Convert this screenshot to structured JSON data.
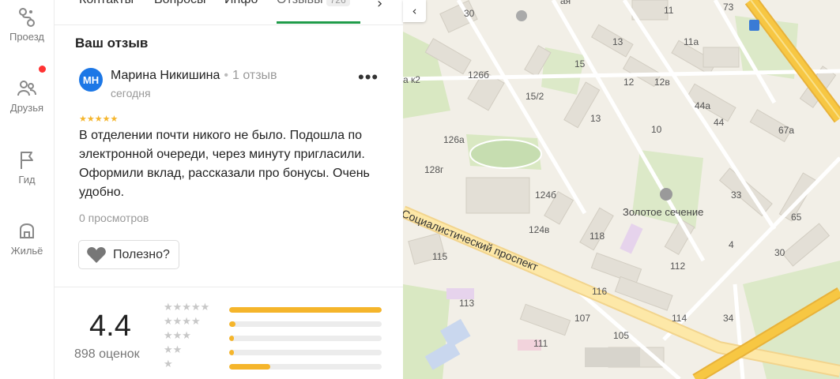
{
  "rail": {
    "items": [
      {
        "label": "Проезд",
        "icon": "route-icon"
      },
      {
        "label": "Друзья",
        "icon": "friends-icon"
      },
      {
        "label": "Гид",
        "icon": "flag-icon"
      },
      {
        "label": "Жильё",
        "icon": "house-icon"
      }
    ]
  },
  "tabs": {
    "items": [
      "Контакты",
      "Вопросы",
      "Инфо",
      "Отзывы"
    ],
    "reviews_count": "726",
    "next": "›"
  },
  "review": {
    "section_title": "Ваш отзыв",
    "avatar": "МН",
    "author": "Марина Никишина",
    "separator": "•",
    "author_reviews": "1 отзыв",
    "date": "сегодня",
    "more": "•••",
    "stars": "★★★★★",
    "rating": 5,
    "text": "В отделении почти никого не было. Подошла по электронной очереди, через минуту пригласили. Оформили вклад, рассказали про бонусы. Очень удобно.",
    "views": "0 просмотров",
    "useful_label": "Полезно?"
  },
  "summary": {
    "rating": "4.4",
    "count": "898 оценок",
    "distribution": [
      {
        "stars": "★★★★★",
        "fraction": 1.0
      },
      {
        "stars": "★★★★",
        "fraction": 0.04
      },
      {
        "stars": "★★★",
        "fraction": 0.02
      },
      {
        "stars": "★★",
        "fraction": 0.02
      },
      {
        "stars": "★",
        "fraction": 0.27
      }
    ]
  },
  "map": {
    "street_name": "Социалистический проспект",
    "place_name": "Золотое сечение",
    "street_top": "ая",
    "collapse": "‹",
    "house_numbers": [
      "30",
      "11",
      "73",
      "126б",
      "15",
      "13",
      "12",
      "12в",
      "11а",
      "а к2",
      "15/2",
      "44а",
      "13",
      "10",
      "44",
      "126а",
      "67а",
      "128г",
      "124б",
      "33",
      "65",
      "124в",
      "118",
      "4",
      "30",
      "115",
      "112",
      "116",
      "113",
      "107",
      "105",
      "114",
      "34",
      "111"
    ],
    "colors": {
      "road_main": "#f7c743",
      "road_secondary": "#fde8a8",
      "park": "#d9e8c2",
      "building": "#e3dfd6"
    }
  }
}
